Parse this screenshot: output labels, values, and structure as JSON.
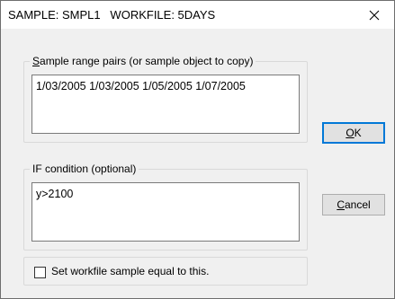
{
  "window": {
    "title": "SAMPLE: SMPL1   WORKFILE: 5DAYS",
    "close_icon": "close-icon"
  },
  "range_group": {
    "label_accel": "S",
    "label_rest": "ample range pairs (or sample object to copy)",
    "value": "1/03/2005 1/03/2005 1/05/2005 1/07/2005"
  },
  "if_group": {
    "label": "IF condition (optional)",
    "value": "y>2100"
  },
  "buttons": {
    "ok_accel": "O",
    "ok_rest": "K",
    "cancel_accel": "C",
    "cancel_rest": "ancel"
  },
  "checkbox": {
    "label": "Set workfile sample equal to this.",
    "checked": false
  }
}
